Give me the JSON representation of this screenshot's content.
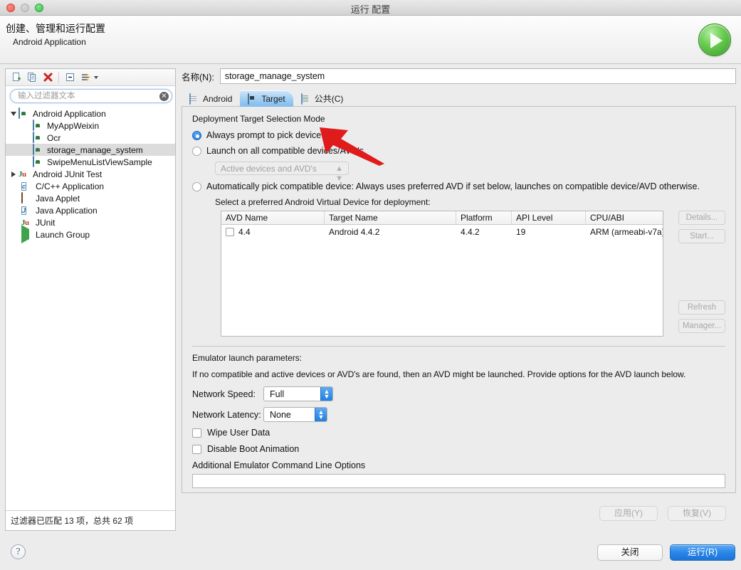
{
  "window": {
    "title": "运行 配置",
    "traffic_lights": [
      "close-red",
      "minimize-gray",
      "zoom-green"
    ]
  },
  "header": {
    "title": "创建、管理和运行配置",
    "subtitle": "Android Application",
    "run_icon": "run-play-icon"
  },
  "left_panel": {
    "toolbar": [
      {
        "name": "new-configuration-icon",
        "glyph": "new"
      },
      {
        "name": "duplicate-configuration-icon",
        "glyph": "copy"
      },
      {
        "name": "delete-configuration-icon",
        "glyph": "delete-x"
      },
      {
        "name": "collapse-all-icon",
        "glyph": "collapse"
      },
      {
        "name": "filter-configurations-icon",
        "glyph": "filter"
      }
    ],
    "filter": {
      "placeholder": "输入过滤器文本",
      "value": "",
      "clear_icon": "✕"
    },
    "tree": [
      {
        "label": "Android Application",
        "icon": "android-icon",
        "indent": 0,
        "disclosure": "open",
        "selected": false
      },
      {
        "label": "MyAppWeixin",
        "icon": "android-icon",
        "indent": 2,
        "disclosure": "none",
        "selected": false
      },
      {
        "label": "Ocr",
        "icon": "android-icon",
        "indent": 2,
        "disclosure": "none",
        "selected": false
      },
      {
        "label": "storage_manage_system",
        "icon": "android-icon",
        "indent": 2,
        "disclosure": "none",
        "selected": true
      },
      {
        "label": "SwipeMenuListViewSample",
        "icon": "android-icon",
        "indent": 2,
        "disclosure": "none",
        "selected": false
      },
      {
        "label": "Android JUnit Test",
        "icon": "junit-android-icon",
        "indent": 0,
        "disclosure": "closed",
        "selected": false
      },
      {
        "label": "C/C++ Application",
        "icon": "cpp-icon",
        "indent": 1,
        "disclosure": "none",
        "selected": false
      },
      {
        "label": "Java Applet",
        "icon": "java-applet-icon",
        "indent": 1,
        "disclosure": "none",
        "selected": false
      },
      {
        "label": "Java Application",
        "icon": "java-application-icon",
        "indent": 1,
        "disclosure": "none",
        "selected": false
      },
      {
        "label": "JUnit",
        "icon": "junit-icon",
        "indent": 1,
        "disclosure": "none",
        "selected": false
      },
      {
        "label": "Launch Group",
        "icon": "launch-group-icon",
        "indent": 1,
        "disclosure": "none",
        "selected": false
      }
    ],
    "status": "过滤器已匹配 13 项，总共 62 项"
  },
  "main": {
    "name_label": "名称(N):",
    "name_value": "storage_manage_system",
    "tabs": [
      {
        "label": "Android",
        "icon": "android-tab-icon",
        "active": false
      },
      {
        "label": "Target",
        "icon": "target-tab-icon",
        "active": true
      },
      {
        "label": "公共(C)",
        "icon": "common-tab-icon",
        "active": false
      }
    ],
    "deployment": {
      "group_title": "Deployment Target Selection Mode",
      "options": [
        {
          "label": "Always prompt to pick device",
          "selected": true
        },
        {
          "label": "Launch on all compatible devices/AVD's",
          "selected": false
        },
        {
          "label": "Automatically pick compatible device: Always uses preferred AVD if set below, launches on compatible device/AVD otherwise.",
          "selected": false
        }
      ],
      "devices_combo": {
        "value": "Active devices and AVD's",
        "disabled": true
      },
      "avd_label": "Select a preferred Android Virtual Device for deployment:",
      "table": {
        "columns": [
          "AVD Name",
          "Target Name",
          "Platform",
          "API Level",
          "CPU/ABI"
        ],
        "rows": [
          {
            "checked": false,
            "avd_name": "4.4",
            "target_name": "Android 4.4.2",
            "platform": "4.4.2",
            "api_level": "19",
            "cpu_abi": "ARM (armeabi-v7a)"
          }
        ]
      },
      "side_buttons": [
        {
          "label": "Details...",
          "disabled": true
        },
        {
          "label": "Start...",
          "disabled": true
        },
        {
          "label": "Refresh",
          "disabled": true
        },
        {
          "label": "Manager...",
          "disabled": true
        }
      ]
    },
    "emulator": {
      "title": "Emulator launch parameters:",
      "note": "If no compatible and active devices or AVD's are found, then an AVD might be launched. Provide options for the AVD launch below.",
      "network_speed": {
        "label": "Network Speed:",
        "value": "Full"
      },
      "network_latency": {
        "label": "Network Latency:",
        "value": "None"
      },
      "checkboxes": [
        {
          "label": "Wipe User Data",
          "checked": false
        },
        {
          "label": "Disable Boot Animation",
          "checked": false
        }
      ],
      "additional_label": "Additional Emulator Command Line Options",
      "additional_value": ""
    },
    "apply_buttons": [
      {
        "label": "应用(Y)",
        "disabled": true
      },
      {
        "label": "恢复(V)",
        "disabled": true
      }
    ]
  },
  "footer": {
    "help_icon": "?",
    "close_label": "关闭",
    "run_label": "运行(R)"
  },
  "annotation": {
    "arrow_color": "#e01b1b",
    "points_to": "Always prompt to pick device"
  },
  "colors": {
    "accent_blue": "#1a7ee0",
    "run_green": "#3a9b2c",
    "annotation_red": "#e01b1b",
    "window_bg": "#ececec"
  }
}
